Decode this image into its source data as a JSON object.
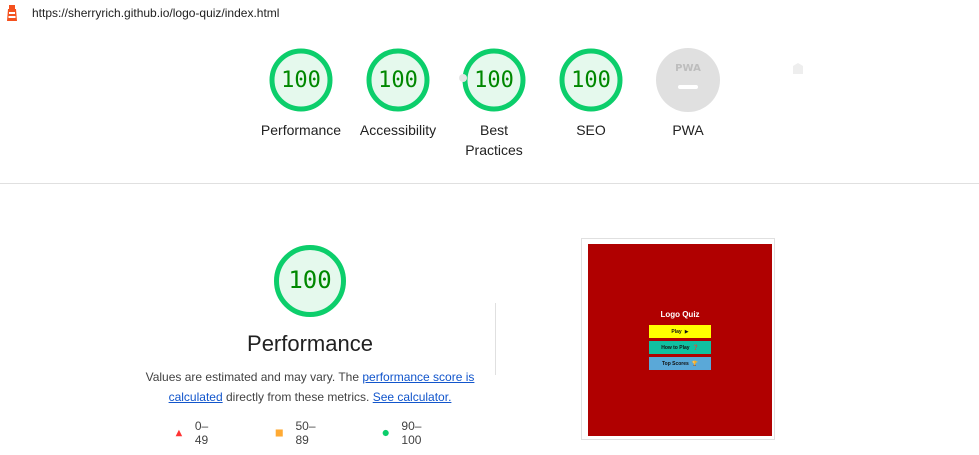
{
  "header": {
    "url": "https://sherryrich.github.io/logo-quiz/index.html",
    "logo_icon": "lighthouse-icon"
  },
  "categories": [
    {
      "id": "performance",
      "score": "100",
      "label": "Performance"
    },
    {
      "id": "accessibility",
      "score": "100",
      "label": "Accessibility"
    },
    {
      "id": "best-practices",
      "score": "100",
      "label": "Best Practices"
    },
    {
      "id": "seo",
      "score": "100",
      "label": "SEO"
    },
    {
      "id": "pwa",
      "score": "",
      "badge": "PWA",
      "label": "PWA"
    }
  ],
  "performance": {
    "score": "100",
    "title": "Performance",
    "desc_prefix": "Values are estimated and may vary. The ",
    "link_score": "performance score is calculated",
    "desc_middle": " directly from these metrics. ",
    "link_calc": "See calculator."
  },
  "legend": [
    {
      "shape": "triangle",
      "color": "#ff3333",
      "range": "0–49"
    },
    {
      "shape": "square",
      "color": "#ffaa33",
      "range": "50–89"
    },
    {
      "shape": "circle",
      "color": "#0cce6b",
      "range": "90–100"
    }
  ],
  "screenshot": {
    "title": "Logo Quiz",
    "buttons": [
      {
        "label": "Play",
        "icon": "play-icon",
        "symbol": "▶",
        "color": "#ffff00"
      },
      {
        "label": "How to Play",
        "icon": "question-icon",
        "symbol": "❓",
        "color": "#11c0a0"
      },
      {
        "label": "Top Scores",
        "icon": "trophy-icon",
        "symbol": "🏆",
        "color": "#5aa8d8"
      }
    ],
    "background": "#b00000"
  },
  "colors": {
    "pass_green": "#0cce6b",
    "pass_fill": "#e5f9ed",
    "score_text": "#008800",
    "pwa_grey": "#e0e0e0",
    "link": "#1155cc"
  }
}
